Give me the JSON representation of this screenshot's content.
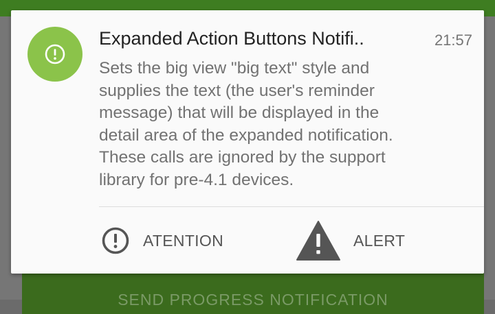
{
  "colors": {
    "accent": "#8bc34a",
    "status_bar": "#3e7d21",
    "app_button": "#3b6b1d"
  },
  "notification": {
    "app_icon": "exclamation-circle-icon",
    "title": "Expanded Action Buttons Notifi..",
    "time": "21:57",
    "body_lines": [
      "Sets the big view \"big text\" style and",
      "supplies the text (the user's reminder",
      "message) that will be displayed  in the",
      "detail area of the expanded notification.",
      "These calls are ignored by the support",
      "library for pre-4.1 devices."
    ],
    "actions": [
      {
        "label": "ATENTION",
        "icon": "exclamation-circle-outline-icon"
      },
      {
        "label": "ALERT",
        "icon": "warning-triangle-icon"
      }
    ]
  },
  "background": {
    "button_label": "SEND PROGRESS NOTIFICATION"
  }
}
